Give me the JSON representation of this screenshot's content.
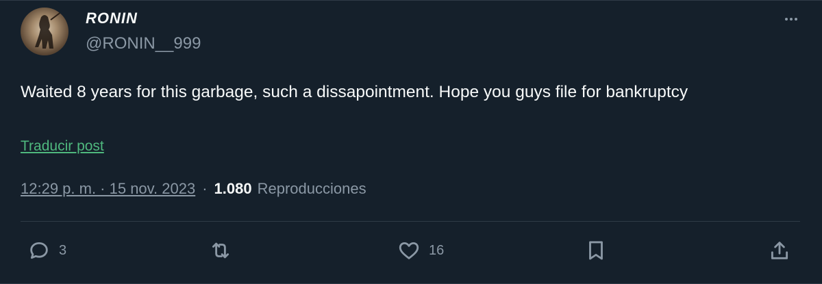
{
  "author": {
    "display_name": "RONIN",
    "handle": "@RONIN__999"
  },
  "post": {
    "text": "Waited 8 years for this garbage, such a dissapointment. Hope you guys file for bankruptcy",
    "translate_label": "Traducir post"
  },
  "meta": {
    "timestamp": "12:29 p. m. · 15 nov. 2023",
    "separator": "·",
    "views_count": "1.080",
    "views_label": "Reproducciones"
  },
  "actions": {
    "replies": "3",
    "likes": "16"
  },
  "icons": [
    "avatar-image",
    "more-icon",
    "reply-icon",
    "retweet-icon",
    "like-icon",
    "bookmark-icon",
    "share-icon"
  ],
  "colors": {
    "background": "#15202b",
    "text": "#f7f9f9",
    "muted": "#8b98a5",
    "translate_link": "#4fb87e",
    "divider": "#2f3b47"
  }
}
